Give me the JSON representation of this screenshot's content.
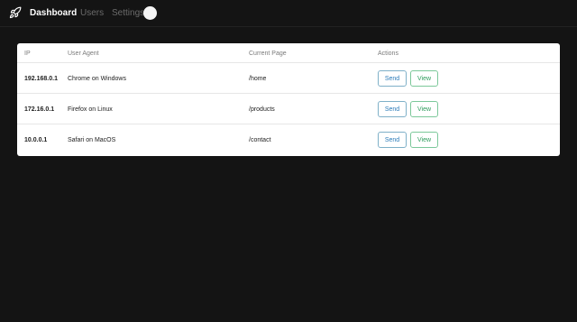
{
  "nav": {
    "logo_icon": "rocket-icon",
    "links": [
      {
        "label": "Dashboard",
        "active": true
      },
      {
        "label": "Users",
        "active": false
      },
      {
        "label": "Settings",
        "active": false
      }
    ],
    "avatar_icon": "avatar-circle"
  },
  "table": {
    "headers": [
      "IP",
      "User Agent",
      "Current Page",
      "Actions"
    ],
    "rows": [
      {
        "ip": "192.168.0.1",
        "user_agent": "Chrome on Windows",
        "page": "/home",
        "send": "Send",
        "view": "View"
      },
      {
        "ip": "172.16.0.1",
        "user_agent": "Firefox on Linux",
        "page": "/products",
        "send": "Send",
        "view": "View"
      },
      {
        "ip": "10.0.0.1",
        "user_agent": "Safari on MacOS",
        "page": "/contact",
        "send": "Send",
        "view": "View"
      }
    ]
  },
  "colors": {
    "background": "#141414",
    "card": "#ffffff",
    "send_button": "#2b7bb9",
    "view_button": "#2e9c5c"
  }
}
